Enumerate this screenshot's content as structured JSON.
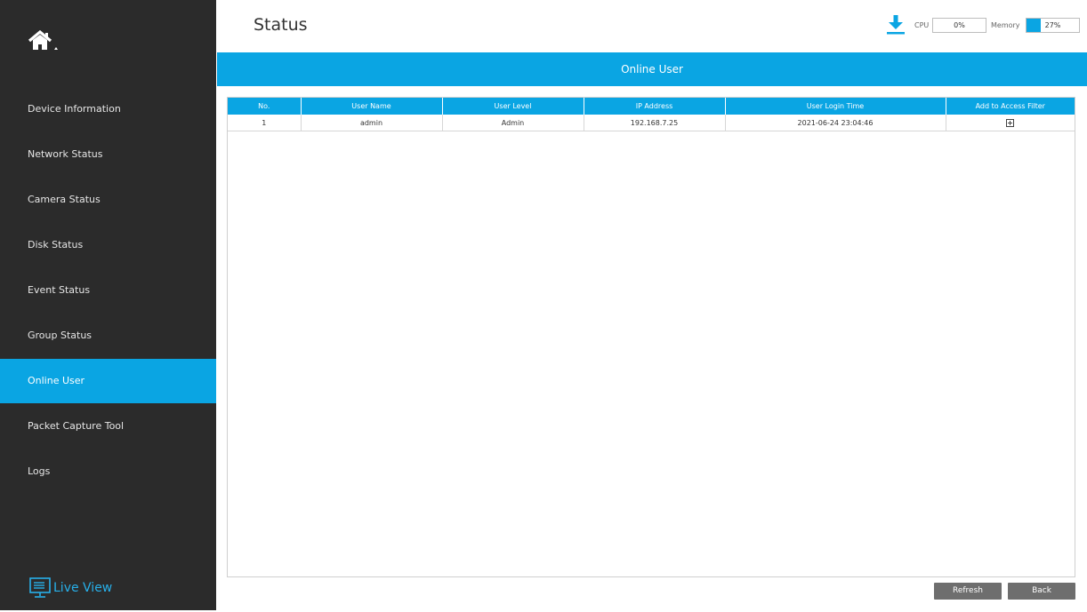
{
  "sidebar": {
    "home_icon": "home-icon",
    "items": [
      {
        "label": "Device Information",
        "active": false
      },
      {
        "label": "Network Status",
        "active": false
      },
      {
        "label": "Camera Status",
        "active": false
      },
      {
        "label": "Disk Status",
        "active": false
      },
      {
        "label": "Event Status",
        "active": false
      },
      {
        "label": "Group Status",
        "active": false
      },
      {
        "label": "Online User",
        "active": true
      },
      {
        "label": "Packet Capture Tool",
        "active": false
      },
      {
        "label": "Logs",
        "active": false
      }
    ],
    "live_view": {
      "label": "Live View",
      "icon": "monitor-icon"
    }
  },
  "header": {
    "title": "Status",
    "download_icon": "download-icon",
    "cpu": {
      "label": "CPU",
      "value": "0%",
      "fraction": 0.0
    },
    "memory": {
      "label": "Memory",
      "value": "27%",
      "fraction": 0.27
    }
  },
  "banner": {
    "title": "Online User"
  },
  "table": {
    "columns": [
      "No.",
      "User Name",
      "User Level",
      "IP Address",
      "User Login Time",
      "Add to Access Filter"
    ],
    "rows": [
      {
        "no": "1",
        "user_name": "admin",
        "user_level": "Admin",
        "ip": "192.168.7.25",
        "login_time": "2021-06-24 23:04:46",
        "action_icon": "plus-box-icon"
      }
    ]
  },
  "buttons": {
    "refresh": "Refresh",
    "back": "Back"
  },
  "colors": {
    "accent": "#0aa5e3",
    "sidebar": "#2b2b2b",
    "button": "#6e6e6e"
  }
}
